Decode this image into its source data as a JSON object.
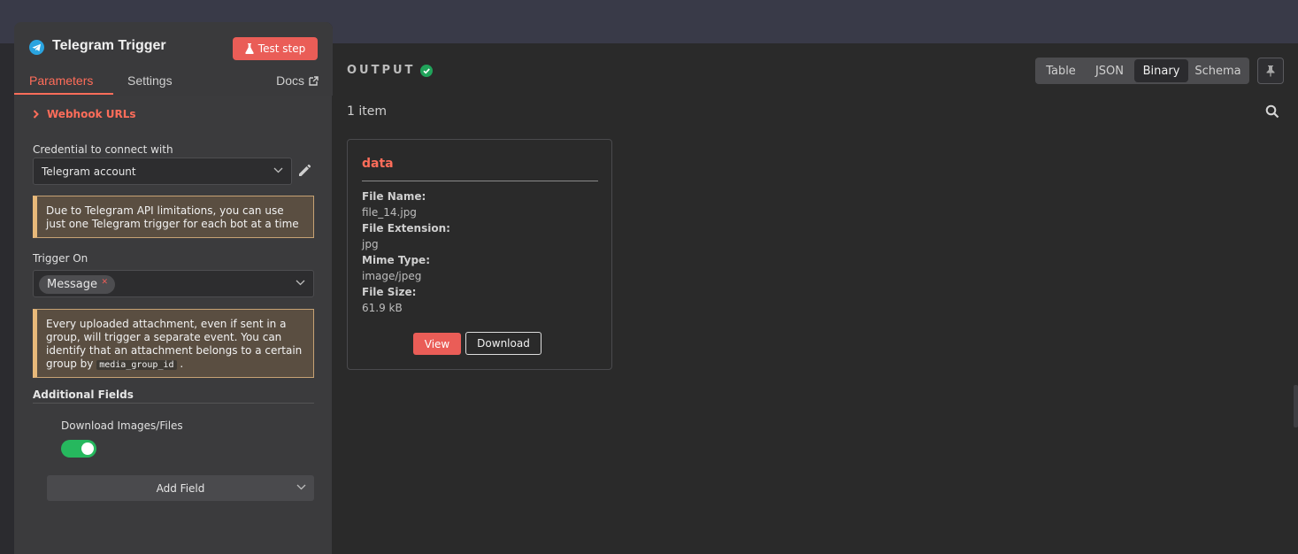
{
  "node": {
    "title": "Telegram Trigger",
    "test_button": "Test step",
    "icon": "telegram-icon"
  },
  "tabs": {
    "parameters": "Parameters",
    "settings": "Settings",
    "docs": "Docs",
    "active": "Parameters"
  },
  "params": {
    "webhook_label": "Webhook URLs",
    "credential_label": "Credential to connect with",
    "credential_value": "Telegram account",
    "notice_1": "Due to Telegram API limitations, you can use just one Telegram trigger for each bot at a time",
    "trigger_on_label": "Trigger On",
    "trigger_chip": "Message",
    "notice_2_text": "Every uploaded attachment, even if sent in a group, will trigger a separate event. You can identify that an attachment belongs to a certain group by",
    "notice_2_code": "media_group_id",
    "notice_2_end": ".",
    "additional_fields_title": "Additional Fields",
    "download_label": "Download Images/Files",
    "download_enabled": true,
    "add_field": "Add Field"
  },
  "output": {
    "title": "OUTPUT",
    "view_tabs": [
      "Table",
      "JSON",
      "Binary",
      "Schema"
    ],
    "active_view": "Binary",
    "item_count": "1 item",
    "card": {
      "title": "data",
      "fields": [
        {
          "key": "File Name:",
          "value": "file_14.jpg"
        },
        {
          "key": "File Extension:",
          "value": "jpg"
        },
        {
          "key": "Mime Type:",
          "value": "image/jpeg"
        },
        {
          "key": "File Size:",
          "value": "61.9 kB"
        }
      ],
      "view_button": "View",
      "download_button": "Download"
    }
  },
  "colors": {
    "accent": "#ff6d5a",
    "button": "#ea5d57",
    "success": "#20a35a",
    "toggle_on": "#26b85e",
    "telegram": "#2aa4e0"
  }
}
